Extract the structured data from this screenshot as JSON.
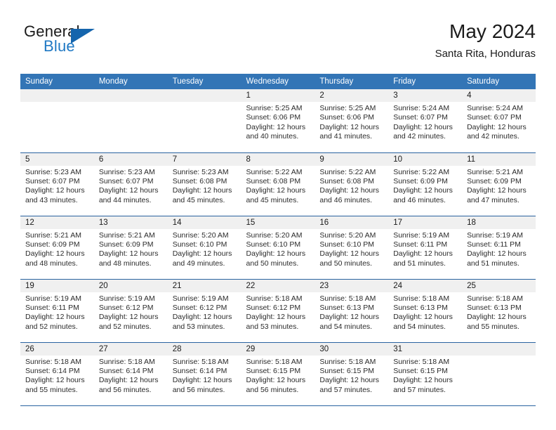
{
  "brand": {
    "general": "General",
    "blue": "Blue",
    "flag_icon": "blue-triangle-flag-icon"
  },
  "header": {
    "title": "May 2024",
    "subtitle": "Santa Rita, Honduras"
  },
  "colors": {
    "header_blue": "#3375b6",
    "row_divider_blue": "#2a63a0",
    "daynum_band": "#f0f0f0",
    "brand_blue": "#2079c4",
    "flag_blue": "#1565ad",
    "text": "#1b1b1b"
  },
  "labels": {
    "sunrise": "Sunrise:",
    "sunset": "Sunset:",
    "daylight": "Daylight:"
  },
  "weekdays": [
    "Sunday",
    "Monday",
    "Tuesday",
    "Wednesday",
    "Thursday",
    "Friday",
    "Saturday"
  ],
  "weeks": [
    [
      {
        "day": "",
        "empty": true
      },
      {
        "day": "",
        "empty": true
      },
      {
        "day": "",
        "empty": true
      },
      {
        "day": "1",
        "sunrise": "Sunrise: 5:25 AM",
        "sunset": "Sunset: 6:06 PM",
        "daylight1": "Daylight: 12 hours",
        "daylight2": "and 40 minutes."
      },
      {
        "day": "2",
        "sunrise": "Sunrise: 5:25 AM",
        "sunset": "Sunset: 6:06 PM",
        "daylight1": "Daylight: 12 hours",
        "daylight2": "and 41 minutes."
      },
      {
        "day": "3",
        "sunrise": "Sunrise: 5:24 AM",
        "sunset": "Sunset: 6:07 PM",
        "daylight1": "Daylight: 12 hours",
        "daylight2": "and 42 minutes."
      },
      {
        "day": "4",
        "sunrise": "Sunrise: 5:24 AM",
        "sunset": "Sunset: 6:07 PM",
        "daylight1": "Daylight: 12 hours",
        "daylight2": "and 42 minutes."
      }
    ],
    [
      {
        "day": "5",
        "sunrise": "Sunrise: 5:23 AM",
        "sunset": "Sunset: 6:07 PM",
        "daylight1": "Daylight: 12 hours",
        "daylight2": "and 43 minutes."
      },
      {
        "day": "6",
        "sunrise": "Sunrise: 5:23 AM",
        "sunset": "Sunset: 6:07 PM",
        "daylight1": "Daylight: 12 hours",
        "daylight2": "and 44 minutes."
      },
      {
        "day": "7",
        "sunrise": "Sunrise: 5:23 AM",
        "sunset": "Sunset: 6:08 PM",
        "daylight1": "Daylight: 12 hours",
        "daylight2": "and 45 minutes."
      },
      {
        "day": "8",
        "sunrise": "Sunrise: 5:22 AM",
        "sunset": "Sunset: 6:08 PM",
        "daylight1": "Daylight: 12 hours",
        "daylight2": "and 45 minutes."
      },
      {
        "day": "9",
        "sunrise": "Sunrise: 5:22 AM",
        "sunset": "Sunset: 6:08 PM",
        "daylight1": "Daylight: 12 hours",
        "daylight2": "and 46 minutes."
      },
      {
        "day": "10",
        "sunrise": "Sunrise: 5:22 AM",
        "sunset": "Sunset: 6:09 PM",
        "daylight1": "Daylight: 12 hours",
        "daylight2": "and 46 minutes."
      },
      {
        "day": "11",
        "sunrise": "Sunrise: 5:21 AM",
        "sunset": "Sunset: 6:09 PM",
        "daylight1": "Daylight: 12 hours",
        "daylight2": "and 47 minutes."
      }
    ],
    [
      {
        "day": "12",
        "sunrise": "Sunrise: 5:21 AM",
        "sunset": "Sunset: 6:09 PM",
        "daylight1": "Daylight: 12 hours",
        "daylight2": "and 48 minutes."
      },
      {
        "day": "13",
        "sunrise": "Sunrise: 5:21 AM",
        "sunset": "Sunset: 6:09 PM",
        "daylight1": "Daylight: 12 hours",
        "daylight2": "and 48 minutes."
      },
      {
        "day": "14",
        "sunrise": "Sunrise: 5:20 AM",
        "sunset": "Sunset: 6:10 PM",
        "daylight1": "Daylight: 12 hours",
        "daylight2": "and 49 minutes."
      },
      {
        "day": "15",
        "sunrise": "Sunrise: 5:20 AM",
        "sunset": "Sunset: 6:10 PM",
        "daylight1": "Daylight: 12 hours",
        "daylight2": "and 50 minutes."
      },
      {
        "day": "16",
        "sunrise": "Sunrise: 5:20 AM",
        "sunset": "Sunset: 6:10 PM",
        "daylight1": "Daylight: 12 hours",
        "daylight2": "and 50 minutes."
      },
      {
        "day": "17",
        "sunrise": "Sunrise: 5:19 AM",
        "sunset": "Sunset: 6:11 PM",
        "daylight1": "Daylight: 12 hours",
        "daylight2": "and 51 minutes."
      },
      {
        "day": "18",
        "sunrise": "Sunrise: 5:19 AM",
        "sunset": "Sunset: 6:11 PM",
        "daylight1": "Daylight: 12 hours",
        "daylight2": "and 51 minutes."
      }
    ],
    [
      {
        "day": "19",
        "sunrise": "Sunrise: 5:19 AM",
        "sunset": "Sunset: 6:11 PM",
        "daylight1": "Daylight: 12 hours",
        "daylight2": "and 52 minutes."
      },
      {
        "day": "20",
        "sunrise": "Sunrise: 5:19 AM",
        "sunset": "Sunset: 6:12 PM",
        "daylight1": "Daylight: 12 hours",
        "daylight2": "and 52 minutes."
      },
      {
        "day": "21",
        "sunrise": "Sunrise: 5:19 AM",
        "sunset": "Sunset: 6:12 PM",
        "daylight1": "Daylight: 12 hours",
        "daylight2": "and 53 minutes."
      },
      {
        "day": "22",
        "sunrise": "Sunrise: 5:18 AM",
        "sunset": "Sunset: 6:12 PM",
        "daylight1": "Daylight: 12 hours",
        "daylight2": "and 53 minutes."
      },
      {
        "day": "23",
        "sunrise": "Sunrise: 5:18 AM",
        "sunset": "Sunset: 6:13 PM",
        "daylight1": "Daylight: 12 hours",
        "daylight2": "and 54 minutes."
      },
      {
        "day": "24",
        "sunrise": "Sunrise: 5:18 AM",
        "sunset": "Sunset: 6:13 PM",
        "daylight1": "Daylight: 12 hours",
        "daylight2": "and 54 minutes."
      },
      {
        "day": "25",
        "sunrise": "Sunrise: 5:18 AM",
        "sunset": "Sunset: 6:13 PM",
        "daylight1": "Daylight: 12 hours",
        "daylight2": "and 55 minutes."
      }
    ],
    [
      {
        "day": "26",
        "sunrise": "Sunrise: 5:18 AM",
        "sunset": "Sunset: 6:14 PM",
        "daylight1": "Daylight: 12 hours",
        "daylight2": "and 55 minutes."
      },
      {
        "day": "27",
        "sunrise": "Sunrise: 5:18 AM",
        "sunset": "Sunset: 6:14 PM",
        "daylight1": "Daylight: 12 hours",
        "daylight2": "and 56 minutes."
      },
      {
        "day": "28",
        "sunrise": "Sunrise: 5:18 AM",
        "sunset": "Sunset: 6:14 PM",
        "daylight1": "Daylight: 12 hours",
        "daylight2": "and 56 minutes."
      },
      {
        "day": "29",
        "sunrise": "Sunrise: 5:18 AM",
        "sunset": "Sunset: 6:15 PM",
        "daylight1": "Daylight: 12 hours",
        "daylight2": "and 56 minutes."
      },
      {
        "day": "30",
        "sunrise": "Sunrise: 5:18 AM",
        "sunset": "Sunset: 6:15 PM",
        "daylight1": "Daylight: 12 hours",
        "daylight2": "and 57 minutes."
      },
      {
        "day": "31",
        "sunrise": "Sunrise: 5:18 AM",
        "sunset": "Sunset: 6:15 PM",
        "daylight1": "Daylight: 12 hours",
        "daylight2": "and 57 minutes."
      },
      {
        "day": "",
        "empty": true
      }
    ]
  ]
}
